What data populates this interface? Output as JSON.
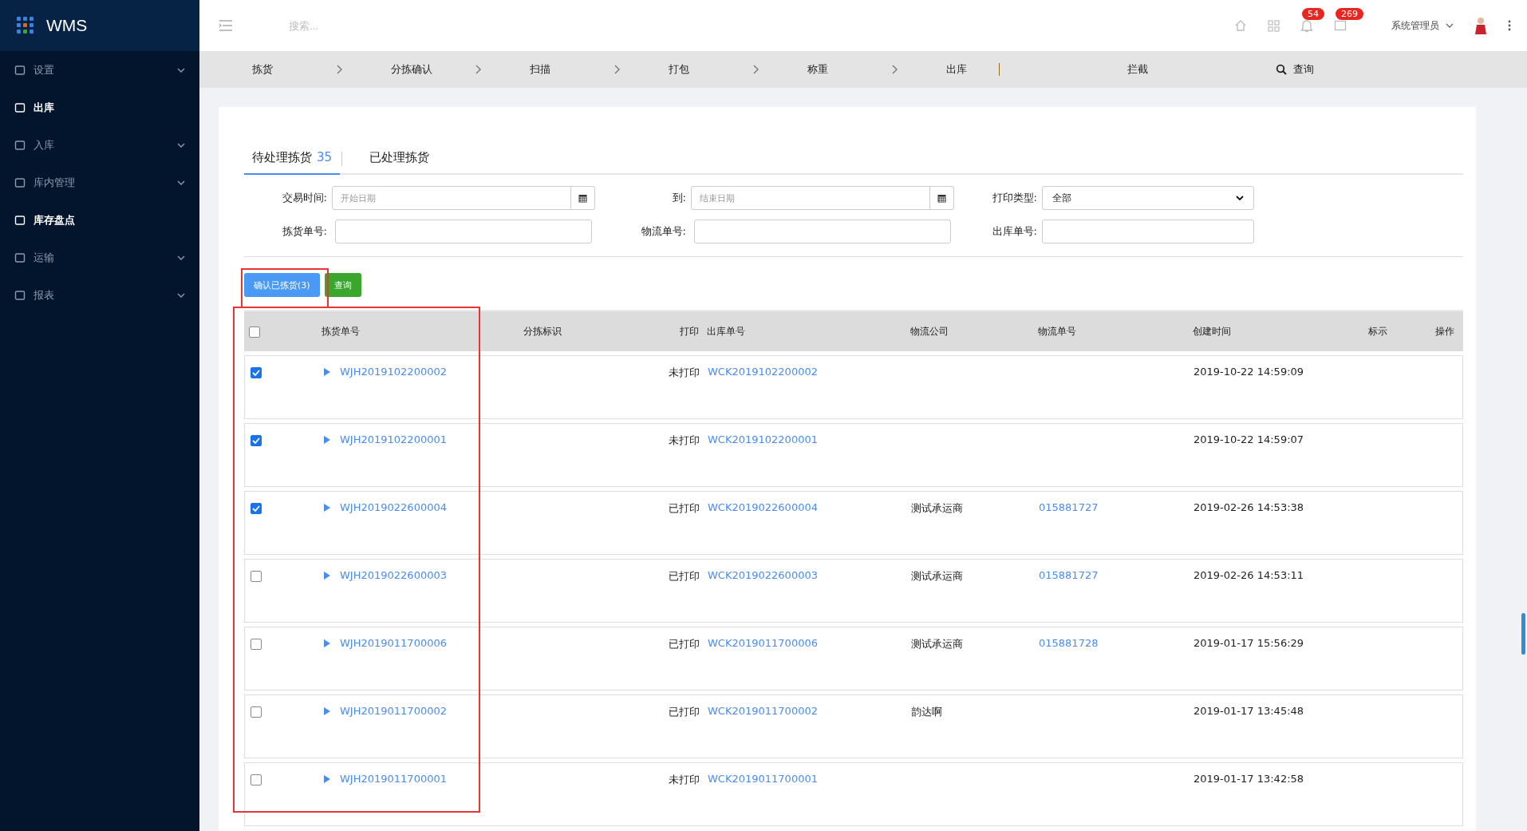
{
  "brand": "WMS",
  "sidebar": {
    "items": [
      {
        "label": "设置",
        "expandable": true,
        "active": false
      },
      {
        "label": "出库",
        "expandable": false,
        "active": true
      },
      {
        "label": "入库",
        "expandable": true,
        "active": false
      },
      {
        "label": "库内管理",
        "expandable": true,
        "active": false
      },
      {
        "label": "库存盘点",
        "expandable": false,
        "active": true
      },
      {
        "label": "运输",
        "expandable": true,
        "active": false
      },
      {
        "label": "报表",
        "expandable": true,
        "active": false
      }
    ]
  },
  "topbar": {
    "search_placeholder": "搜索...",
    "notification_count": "54",
    "message_count": "269",
    "user": "系统管理员"
  },
  "steps": [
    "拣货",
    "分拣确认",
    "扫描",
    "打包",
    "称重",
    "出库"
  ],
  "step_extra": "拦截",
  "step_search": "查询",
  "tabs": [
    {
      "label": "待处理拣货",
      "count": "35",
      "selected": true
    },
    {
      "label": "已处理拣货",
      "selected": false
    }
  ],
  "filters": {
    "date_label": "交易时间:",
    "start_placeholder": "开始日期",
    "to_label": "到:",
    "end_placeholder": "结束日期",
    "print_type_label": "打印类型:",
    "print_type_value": "全部",
    "pick_no_label": "拣货单号:",
    "tracking_no_label": "物流单号:",
    "outbound_no_label": "出库单号:"
  },
  "buttons": {
    "confirm": "确认已拣货(3)",
    "query": "查询"
  },
  "table": {
    "select_all_checked": false,
    "columns": [
      "拣货单号",
      "分拣标识",
      "打印",
      "出库单号",
      "物流公司",
      "物流单号",
      "创建时间",
      "标示",
      "操作"
    ],
    "rows": [
      {
        "checked": true,
        "pick_no": "WJH2019102200002",
        "print": "未打印",
        "outbound_no": "WCK2019102200002",
        "created": "2019-10-22 14:59:09"
      },
      {
        "checked": true,
        "pick_no": "WJH2019102200001",
        "print": "未打印",
        "outbound_no": "WCK2019102200001",
        "created": "2019-10-22 14:59:07"
      },
      {
        "checked": true,
        "pick_no": "WJH2019022600004",
        "print": "已打印",
        "outbound_no": "WCK2019022600004",
        "carrier": "测试承运商",
        "tracking_no": "015881727",
        "created": "2019-02-26 14:53:38"
      },
      {
        "checked": false,
        "pick_no": "WJH2019022600003",
        "print": "已打印",
        "outbound_no": "WCK2019022600003",
        "carrier": "测试承运商",
        "tracking_no": "015881727",
        "created": "2019-02-26 14:53:11"
      },
      {
        "checked": false,
        "pick_no": "WJH2019011700006",
        "print": "已打印",
        "outbound_no": "WCK2019011700006",
        "carrier": "测试承运商",
        "tracking_no": "015881728",
        "created": "2019-01-17 15:56:29"
      },
      {
        "checked": false,
        "pick_no": "WJH2019011700002",
        "print": "已打印",
        "outbound_no": "WCK2019011700002",
        "carrier": "韵达啊",
        "created": "2019-01-17 13:45:48"
      },
      {
        "checked": false,
        "pick_no": "WJH2019011700001",
        "print": "未打印",
        "outbound_no": "WCK2019011700001",
        "created": "2019-01-17 13:42:58"
      }
    ]
  }
}
